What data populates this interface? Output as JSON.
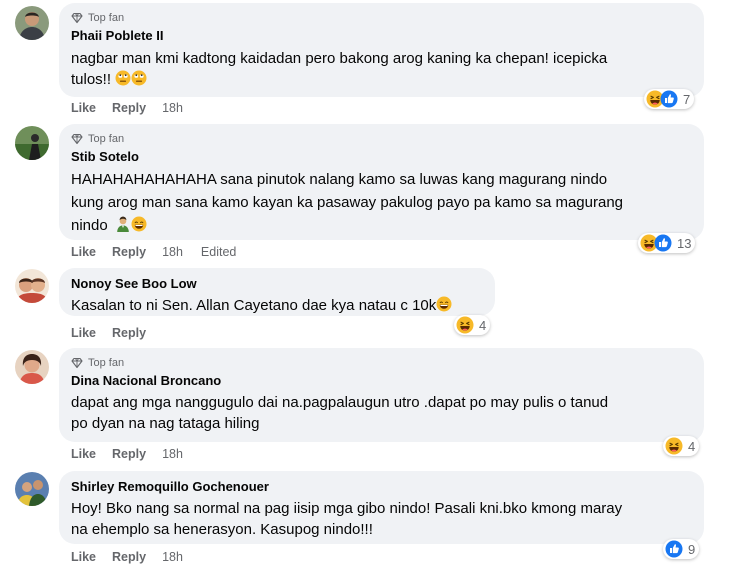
{
  "badges": {
    "top_fan": "Top fan"
  },
  "actions": {
    "like": "Like",
    "reply": "Reply"
  },
  "comments": [
    {
      "author": "Phaii Poblete II",
      "top_fan": true,
      "text_line1": "nagbar man kmi kadtong kaidadan pero bakong arog kaning ka chepan! icepicka",
      "text_line2": "tulos!!",
      "time": "18h",
      "reactions": [
        "haha",
        "like"
      ],
      "reaction_count": "7"
    },
    {
      "author": "Stib Sotelo",
      "top_fan": true,
      "text_line1": "HAHAHAHAHAHAHA sana pinutok nalang kamo sa luwas kang magurang nindo",
      "text_line2": "kung arog man sana kamo kayan ka pasaway pakulog payo pa kamo sa magurang",
      "text_line3": "nindo",
      "time": "18h",
      "edited": "Edited",
      "reactions": [
        "haha",
        "like"
      ],
      "reaction_count": "13"
    },
    {
      "author": "Nonoy See Boo Low",
      "top_fan": false,
      "text_line1": "Kasalan to ni Sen. Allan Cayetano dae kya natau c 10k",
      "time": "",
      "reactions": [
        "haha"
      ],
      "reaction_count": "4"
    },
    {
      "author": "Dina Nacional Broncano",
      "top_fan": true,
      "text_line1": "dapat ang mga nanggugulo dai na.pagpalaugun utro .dapat po may pulis o tanud",
      "text_line2": "po dyan na nag tataga hiling",
      "time": "18h",
      "reactions": [
        "haha"
      ],
      "reaction_count": "4"
    },
    {
      "author": "Shirley Remoquillo Gochenouer",
      "top_fan": false,
      "text_line1": "Hoy! Bko nang sa normal na pag iisip mga gibo nindo! Pasali kni.bko kmong maray",
      "text_line2": "na ehemplo sa henerasyon. Kasupog nindo!!!",
      "time": "18h",
      "reactions": [
        "like"
      ],
      "reaction_count": "9"
    }
  ],
  "colors": {
    "bubble": "#f0f2f5",
    "meta": "#65676b",
    "like_blue": "#1877f2",
    "haha_yellow": "#f7b928"
  }
}
